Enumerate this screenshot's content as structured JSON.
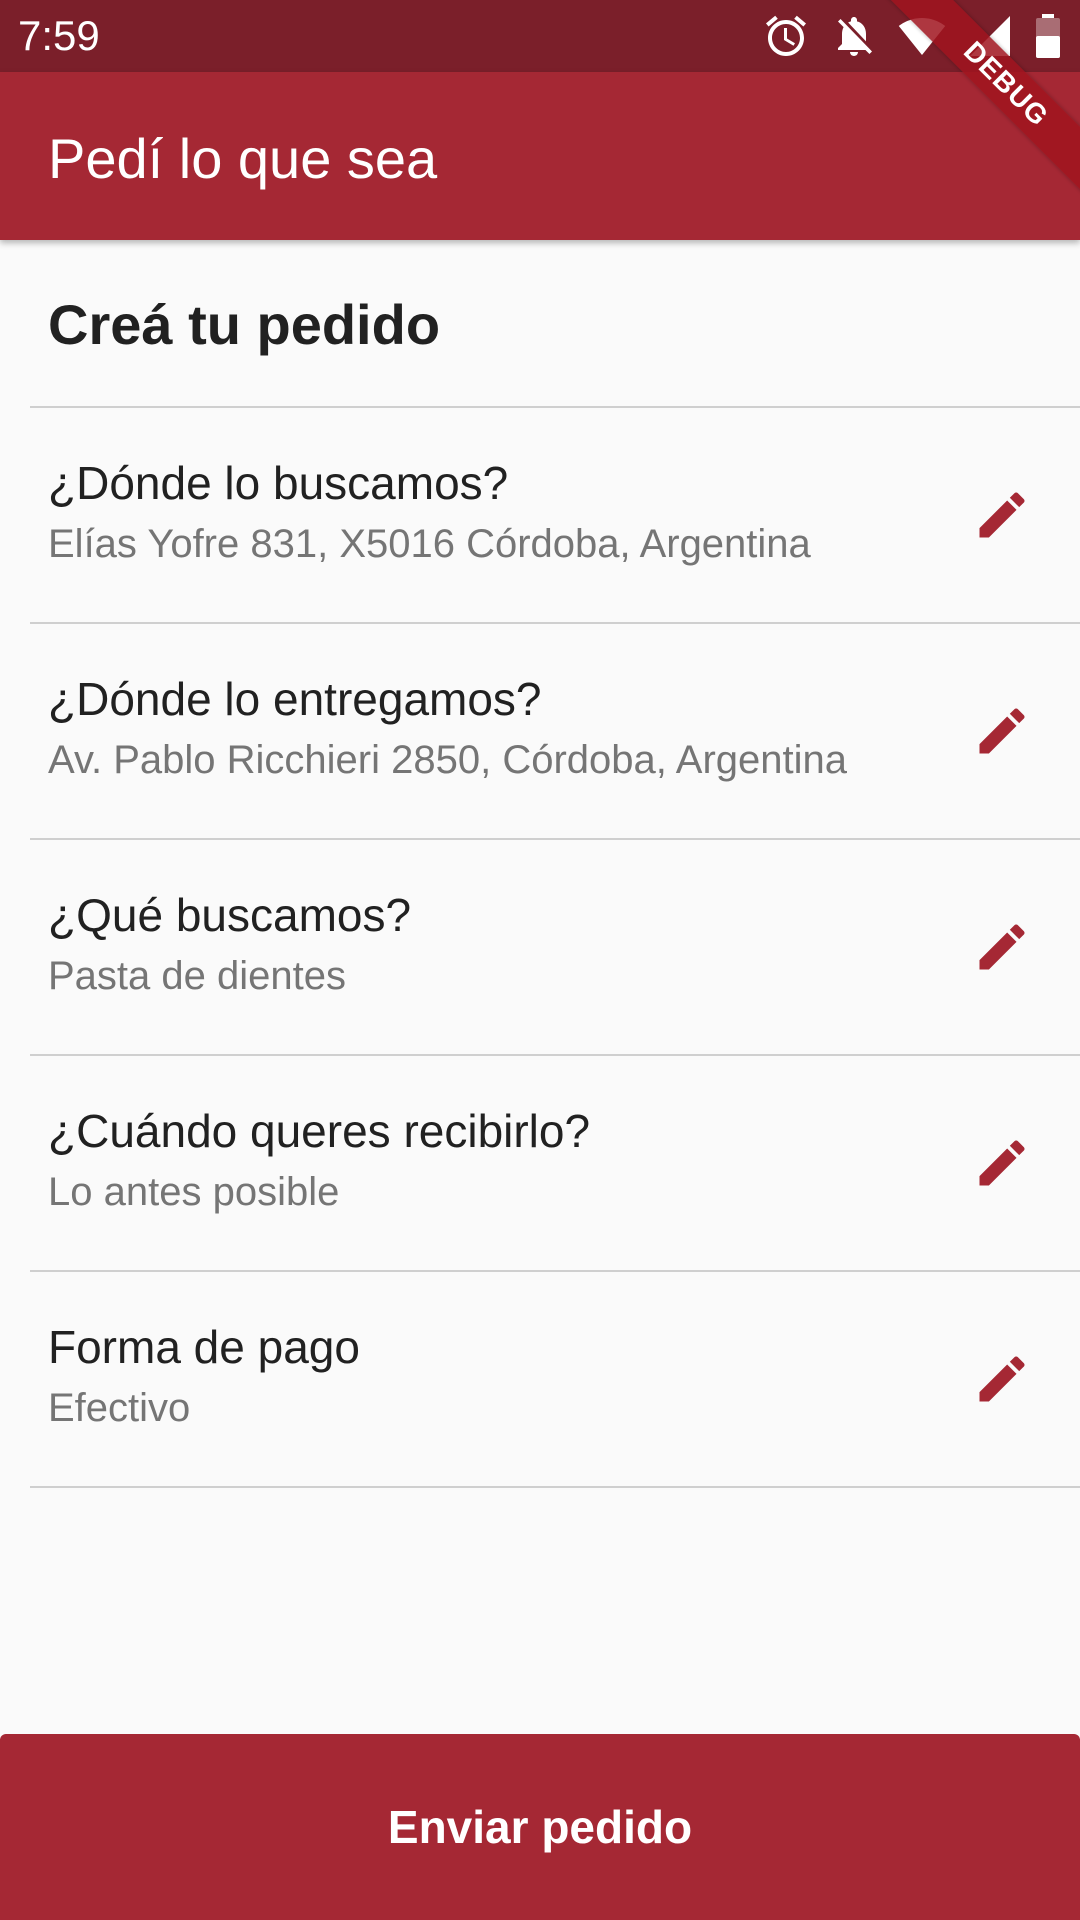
{
  "status_bar": {
    "time": "7:59",
    "icons": [
      "alarm-icon",
      "notifications-off-icon",
      "wifi-icon",
      "cell-signal-icon",
      "battery-icon"
    ]
  },
  "debug_banner": {
    "label": "DEBUG"
  },
  "app_bar": {
    "title": "Pedí lo que sea"
  },
  "page": {
    "section_title": "Creá tu pedido"
  },
  "order_fields": [
    {
      "label": "¿Dónde lo buscamos?",
      "value": "Elías Yofre 831, X5016 Córdoba, Argentina",
      "icon": "edit-icon"
    },
    {
      "label": "¿Dónde lo entregamos?",
      "value": "Av. Pablo Ricchieri 2850, Córdoba, Argentina",
      "icon": "edit-icon"
    },
    {
      "label": "¿Qué buscamos?",
      "value": "Pasta de dientes",
      "icon": "edit-icon"
    },
    {
      "label": "¿Cuándo queres recibirlo?",
      "value": "Lo antes posible",
      "icon": "edit-icon"
    },
    {
      "label": "Forma de pago",
      "value": "Efectivo",
      "icon": "edit-icon"
    }
  ],
  "submit": {
    "label": "Enviar pedido"
  },
  "colors": {
    "status_bar": "#7b1f2a",
    "primary": "#a52834",
    "background": "#fafafa",
    "text_primary": "#212121",
    "text_secondary": "#757575",
    "divider": "#cfcfcf"
  }
}
